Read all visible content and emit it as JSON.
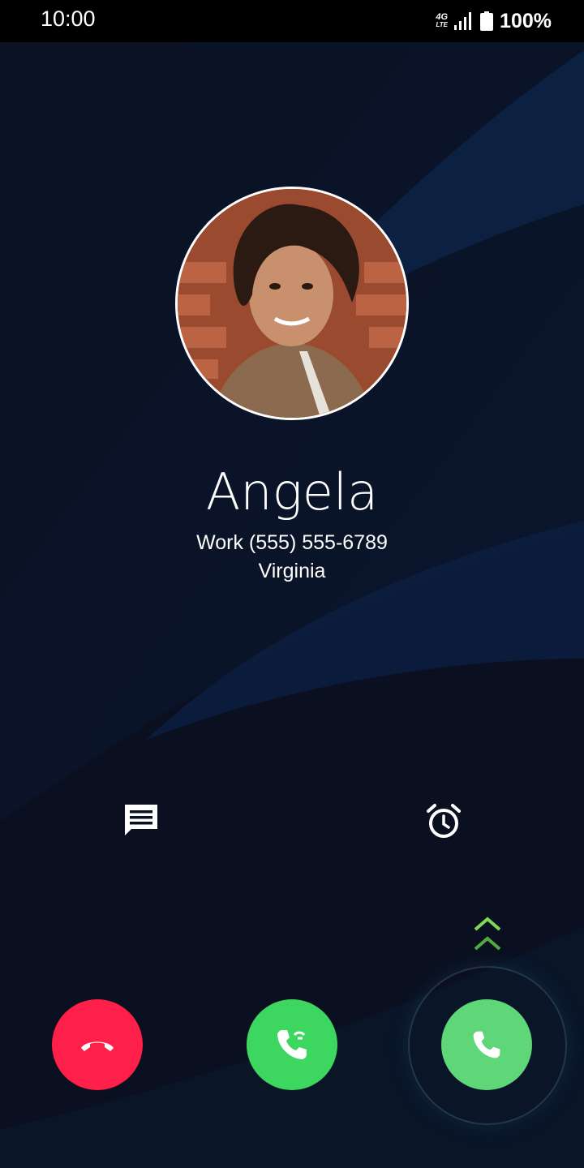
{
  "status_bar": {
    "time": "10:00",
    "network_top": "4G",
    "network_bottom": "LTE",
    "battery_percent": "100%"
  },
  "caller": {
    "name": "Angela",
    "number": "Work (555) 555-6789",
    "location": "Virginia"
  },
  "quick_actions": {
    "message_icon": "message-icon",
    "reminder_icon": "alarm-clock-icon"
  },
  "call_actions": {
    "decline_icon": "phone-hangup-icon",
    "decline_color": "#ff1f4b",
    "answer_hold_icon": "phone-hold-icon",
    "answer_hold_color": "#3dd65e",
    "answer_icon": "phone-icon",
    "answer_color": "#5fd677",
    "swipe_hint_icon": "double-chevron-up-icon"
  }
}
